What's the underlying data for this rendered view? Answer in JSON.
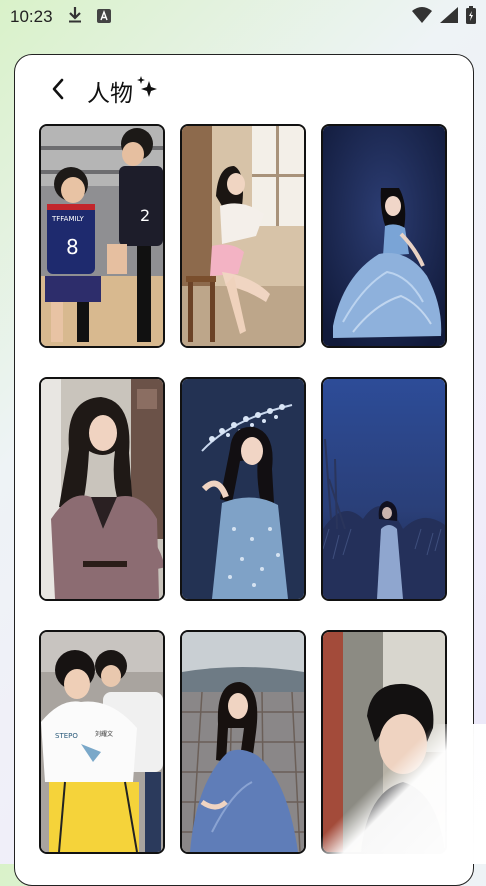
{
  "status_bar": {
    "time": "10:23",
    "left_icons": [
      "download-icon",
      "a-badge-icon"
    ],
    "right_icons": [
      "wifi-icon",
      "signal-icon",
      "battery-icon"
    ]
  },
  "header": {
    "back_icon": "chevron-left-icon",
    "title": "人物",
    "title_icon": "sparkle-icon"
  },
  "grid": {
    "items": [
      {
        "scene": "basketball-boys",
        "jersey_text": "TFFAMILY",
        "jersey_number": "8",
        "jersey_number_2": "2"
      },
      {
        "scene": "girl-window-chair"
      },
      {
        "scene": "woman-blue-gown"
      },
      {
        "scene": "woman-mauve-blouse"
      },
      {
        "scene": "woman-sequin-dress"
      },
      {
        "scene": "woman-night-field"
      },
      {
        "scene": "boys-white-tees",
        "shirt_text": "STEPO",
        "shirt_text_2": "刘耀文"
      },
      {
        "scene": "woman-blue-dress-deck"
      },
      {
        "scene": "man-portrait"
      }
    ]
  },
  "colors": {
    "accent": "#111111",
    "card_bg": "#ffffff",
    "navy": "#1e2a52",
    "night_blue": "#2f4a8a"
  }
}
